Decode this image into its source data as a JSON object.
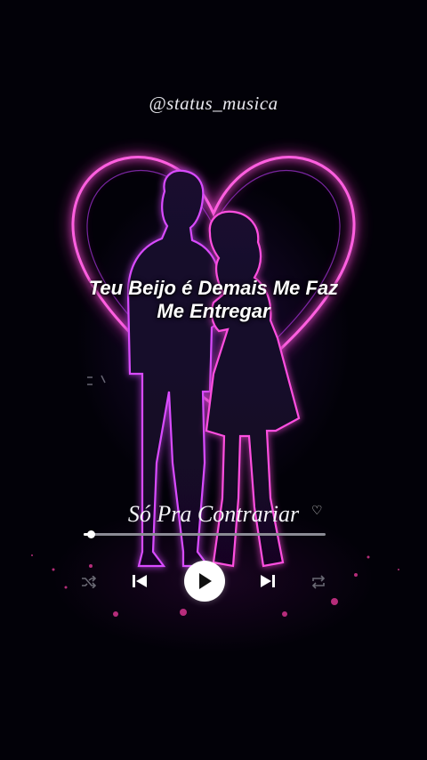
{
  "overlay": {
    "handle": "@status_musica",
    "lyric_line1": "Teu Beijo é Demais Me Faz",
    "lyric_line2": "Me Entregar"
  },
  "player": {
    "song_title": "Só Pra Contrariar",
    "progress": 0.03,
    "controls": [
      "shuffle-icon",
      "previous-icon",
      "play-icon",
      "next-icon",
      "repeat-icon"
    ]
  },
  "colors": {
    "background": "#020108",
    "neon_pink": "#ff3fd8",
    "neon_purple": "#9b3bff",
    "text": "#ffffff"
  }
}
